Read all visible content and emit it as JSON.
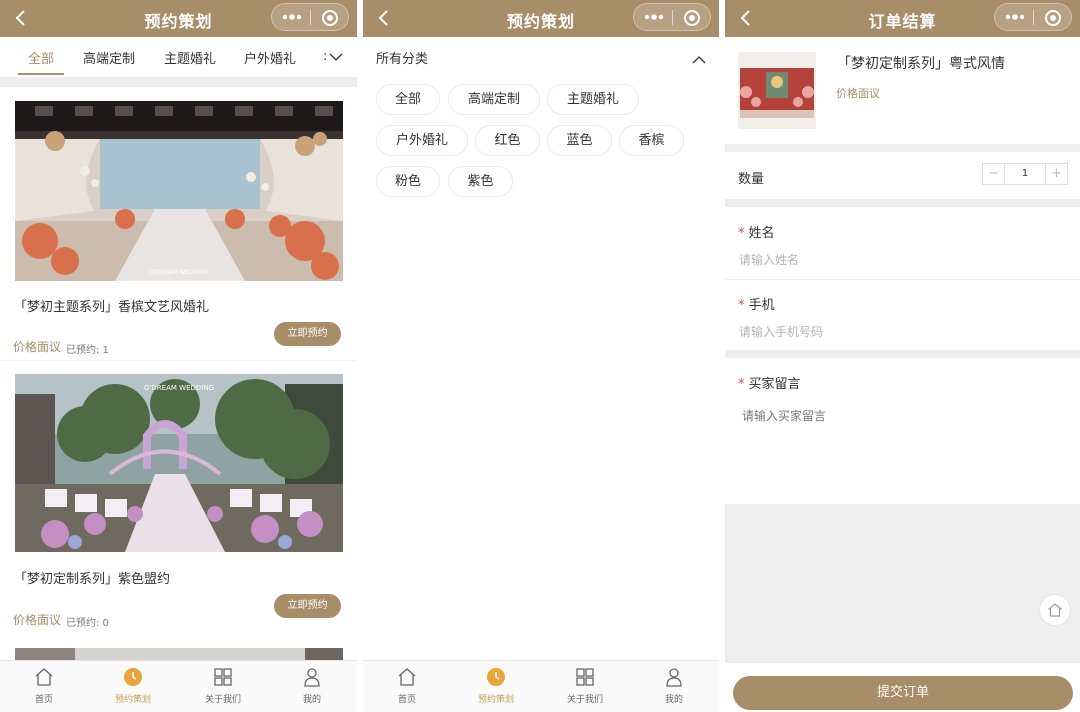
{
  "colors": {
    "brand": "#a78d68",
    "tab_active": "#c8a056",
    "required": "#e0433b"
  },
  "panel_list": {
    "nav_title": "预约策划",
    "tabs": [
      "全部",
      "高端定制",
      "主题婚礼",
      "户外婚礼"
    ],
    "tab_more": ":",
    "cards": [
      {
        "name": "「梦初主题系列」香槟文艺风婚礼",
        "price": "价格面议",
        "booked": "已预约: 1",
        "button": "立即预约",
        "photo_watermark": "O'DREAM WEDDING"
      },
      {
        "name": "「梦初定制系列」紫色盟约",
        "price": "价格面议",
        "booked": "已预约: 0",
        "button": "立即预约",
        "photo_watermark": "O'DREAM WEDDING"
      }
    ]
  },
  "panel_category": {
    "nav_title": "预约策划",
    "section_title": "所有分类",
    "chips": [
      "全部",
      "高端定制",
      "主题婚礼",
      "户外婚礼",
      "红色",
      "蓝色",
      "香槟",
      "粉色",
      "紫色"
    ]
  },
  "panel_checkout": {
    "nav_title": "订单结算",
    "product_name": "「梦初定制系列」粤式风情",
    "product_price": "价格面议",
    "quantity_label": "数量",
    "quantity_value": "1",
    "minus": "−",
    "plus": "+",
    "fields": [
      {
        "label": "姓名",
        "placeholder": "请输入姓名"
      },
      {
        "label": "手机",
        "placeholder": "请输入手机号码"
      },
      {
        "label": "买家留言",
        "placeholder": "请输入买家留言"
      }
    ],
    "required_mark": "*",
    "submit": "提交订单"
  },
  "tabbar": [
    "首页",
    "预约策划",
    "关于我们",
    "我的"
  ],
  "icons": [
    "back-arrow-icon",
    "more-dots-icon",
    "target-circle-icon",
    "chevron-down-icon",
    "chevron-up-icon",
    "home-icon",
    "clock-icon",
    "grid-icon",
    "person-icon"
  ]
}
